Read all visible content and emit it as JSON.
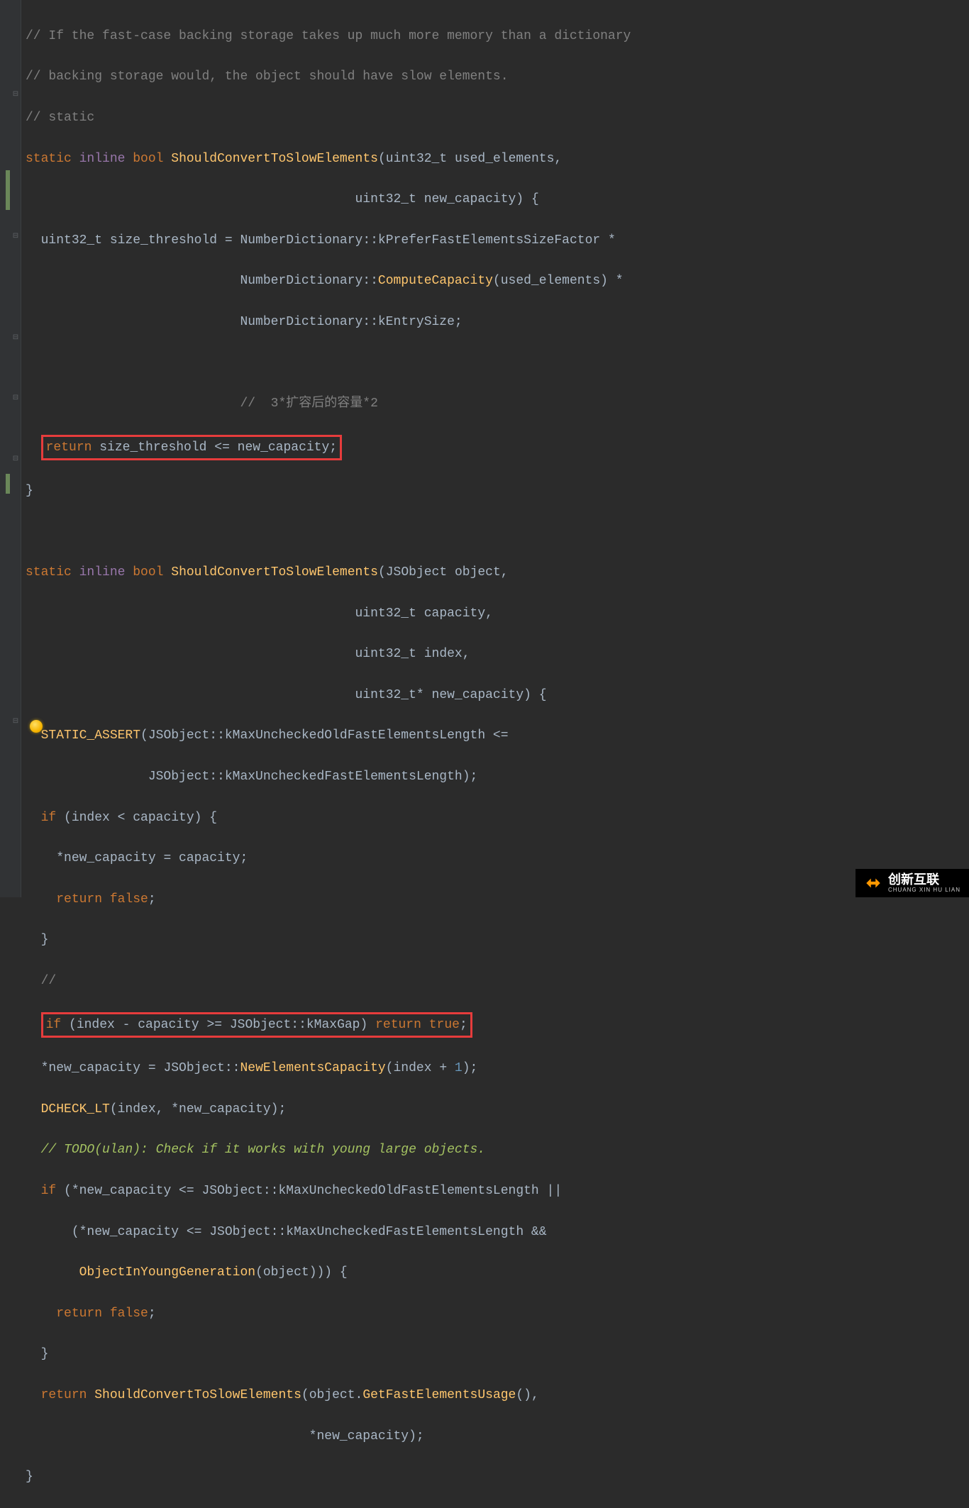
{
  "code": {
    "c1_a": "// If the fast-case backing storage takes up much more memory than a dictionary",
    "c1_b": "// backing storage would, the object should have slow elements.",
    "c1_c": "// static",
    "l2_static": "static",
    "l2_inline": "inline",
    "l2_bool": "bool",
    "l2_fn": "ShouldConvertToSlowElements",
    "l2_p1t": "uint32_t",
    "l2_p1n": "used_elements",
    "l3_p2t": "uint32_t",
    "l3_p2n": "new_capacity",
    "l4_t": "uint32_t",
    "l4_v": "size_threshold",
    "l4_eq": " = ",
    "l4_r1": "NumberDictionary::kPreferFastElementsSizeFactor *",
    "l5_r2": "NumberDictionary::",
    "l5_fn": "ComputeCapacity",
    "l5_arg": "(used_elements) *",
    "l6_r3": "NumberDictionary::kEntrySize;",
    "l7_c": "//  3*扩容后的容量*2",
    "l8_ret": "return",
    "l8_expr": "size_threshold <= new_capacity;",
    "l9_close": "}",
    "f2_static": "static",
    "f2_inline": "inline",
    "f2_bool": "bool",
    "f2_fn": "ShouldConvertToSlowElements",
    "f2_p1": "JSObject object,",
    "f2_p2t": "uint32_t",
    "f2_p2n": "capacity,",
    "f2_p3t": "uint32_t",
    "f2_p3n": "index,",
    "f2_p4t": "uint32_t*",
    "f2_p4n": "new_capacity) {",
    "sa1": "STATIC_ASSERT",
    "sa2": "(JSObject::kMaxUncheckedOldFastElementsLength <=",
    "sa3": "JSObject::kMaxUncheckedFastElementsLength);",
    "if1_kw": "if",
    "if1_cond": " (index < capacity) {",
    "if1_body": "*new_capacity = capacity;",
    "if1_ret": "return",
    "if1_false": "false",
    "if1_semi": ";",
    "if1_close": "}",
    "slashslash": "//",
    "if2_kw": "if",
    "if2_cond": " (index - capacity >= JSObject::kMaxGap) ",
    "if2_ret": "return",
    "if2_true": "true",
    "if2_semi": ";",
    "nc1": "*new_capacity = JSObject::",
    "nc1_fn": "NewElementsCapacity",
    "nc1_args": "(index + ",
    "nc1_num": "1",
    "nc1_end": ");",
    "dc_fn": "DCHECK_LT",
    "dc_args": "(index, *new_capacity);",
    "todo": "// TODO(ulan): Check if it works with young large objects.",
    "if3_kw": "if",
    "if3_l1": " (*new_capacity <= JSObject::kMaxUncheckedOldFastElementsLength ||",
    "if3_l2": "(*new_capacity <= JSObject::kMaxUncheckedFastElementsLength &&",
    "if3_fn": "ObjectInYoungGeneration",
    "if3_l3": "(object))) {",
    "if3_ret": "return",
    "if3_false": "false",
    "if3_semi": ";",
    "if3_close": "}",
    "ret2": "return",
    "ret2_fn": "ShouldConvertToSlowElements",
    "ret2_a1": "(object.",
    "ret2_a1fn": "GetFastElementsUsage",
    "ret2_a1end": "(),",
    "ret2_a2": "*new_capacity);",
    "final_close": "}"
  },
  "watermark": {
    "main": "创新互联",
    "sub": "CHUANG XIN HU LIAN"
  }
}
